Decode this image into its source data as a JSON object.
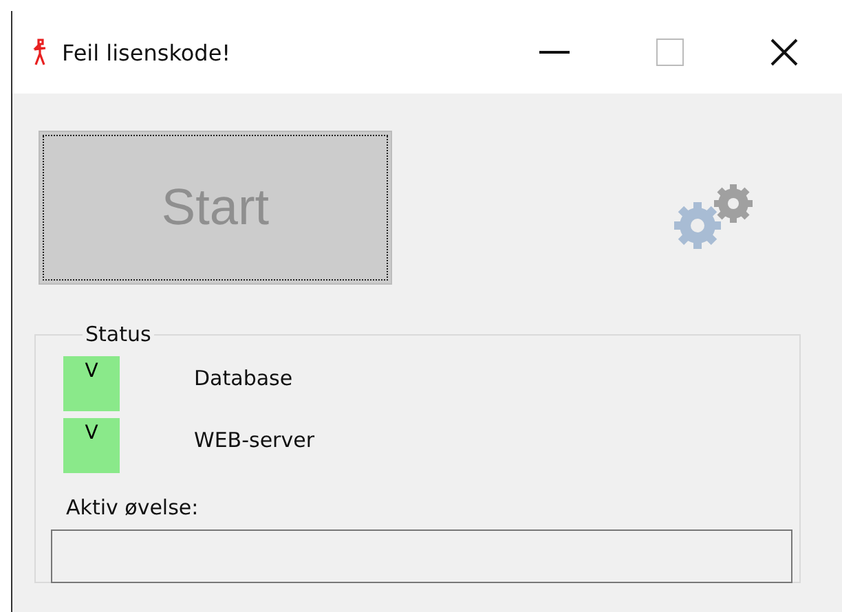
{
  "window": {
    "title": "Feil lisenskode!"
  },
  "start_button": {
    "label": "Start",
    "disabled": true
  },
  "status": {
    "title": "Status",
    "items": [
      {
        "indicator": "V",
        "label": "Database",
        "on": true
      },
      {
        "indicator": "V",
        "label": "WEB-server",
        "on": true
      }
    ]
  },
  "active_exercise": {
    "label": "Aktiv øvelse:"
  }
}
